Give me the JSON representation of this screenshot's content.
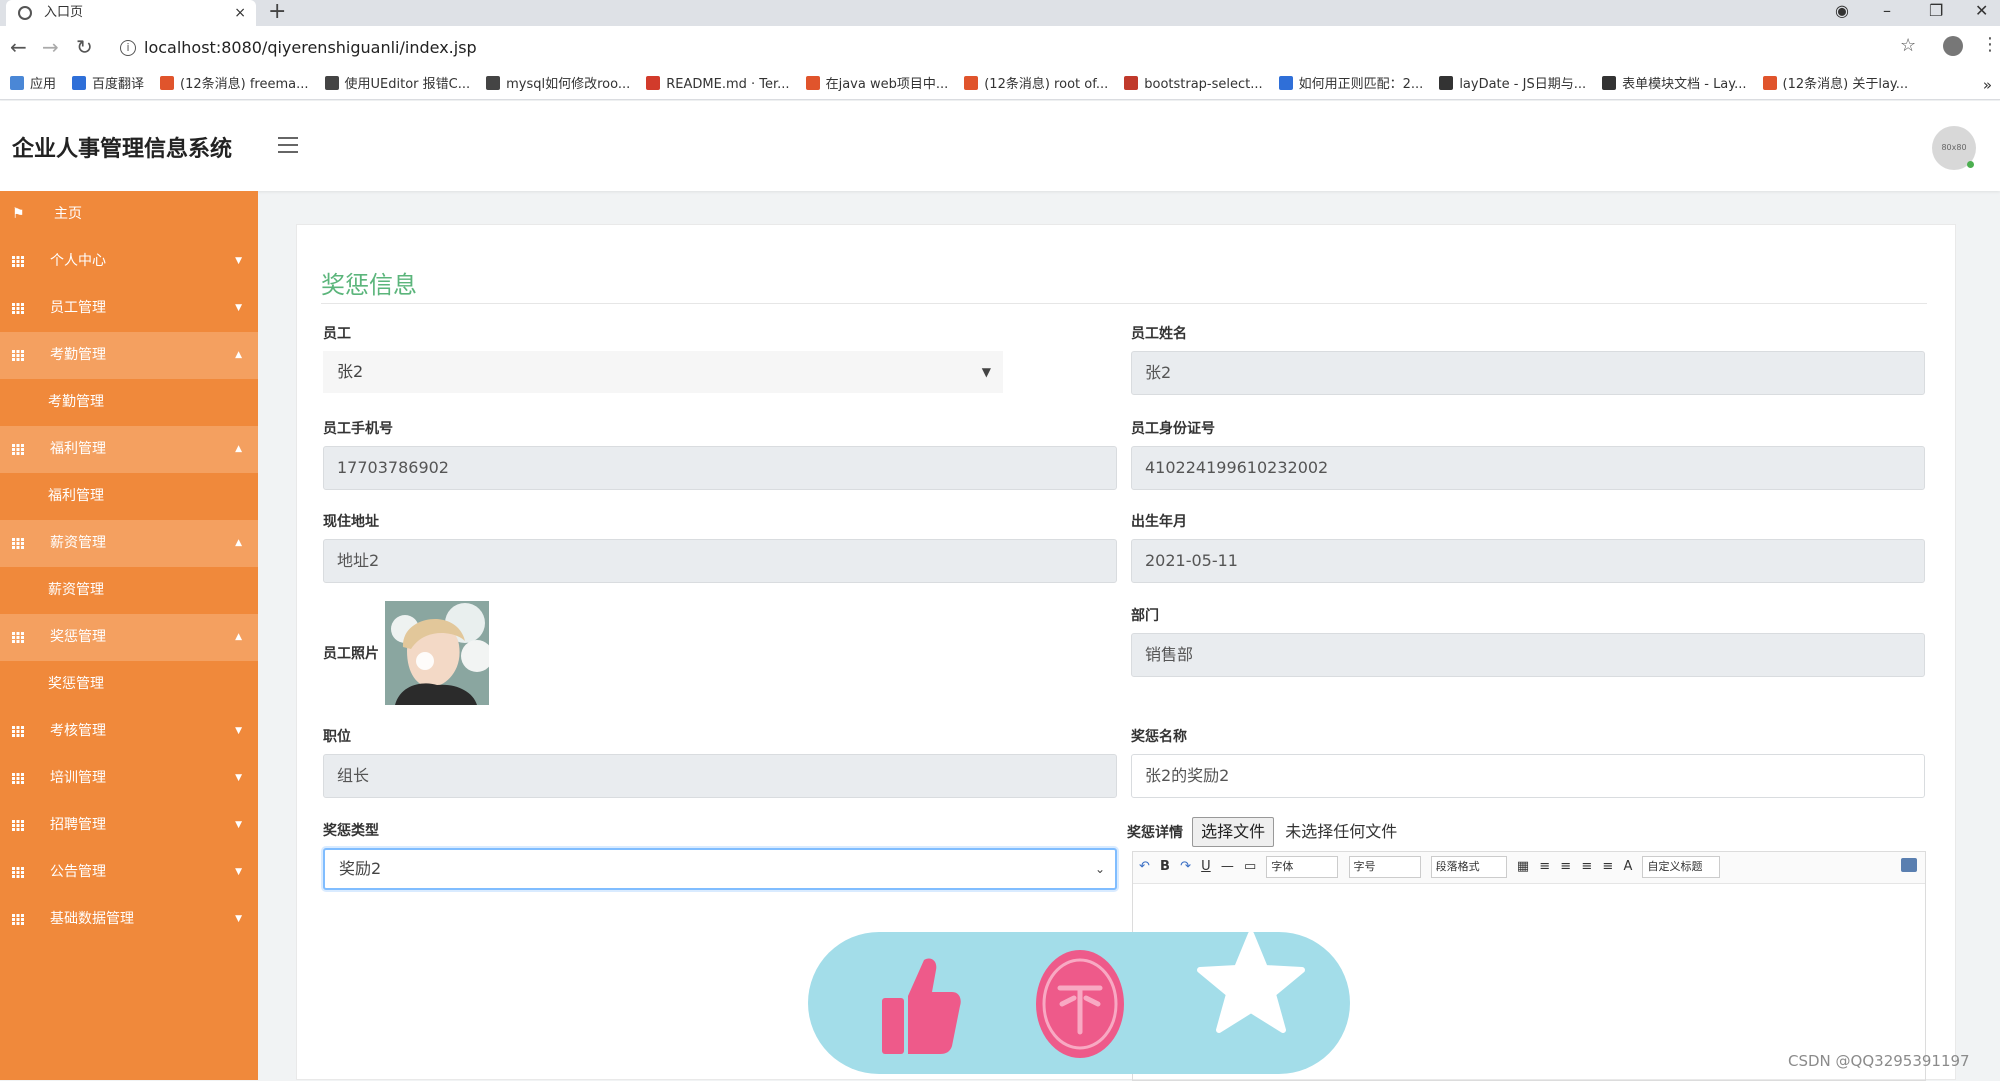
{
  "browser": {
    "tab_title": "入口页",
    "tab_close": "×",
    "new_tab": "+",
    "url": "localhost:8080/qiyerenshiguanli/index.jsp",
    "bookmarks": [
      {
        "label": "应用",
        "color": "#4a87d6"
      },
      {
        "label": "百度翻译",
        "color": "#2f6fd8"
      },
      {
        "label": "(12条消息) freema...",
        "color": "#e0542c"
      },
      {
        "label": "使用UEditor 报错C...",
        "color": "#444444"
      },
      {
        "label": "mysql如何修改roo...",
        "color": "#444444"
      },
      {
        "label": "README.md · Ter...",
        "color": "#d23b2b"
      },
      {
        "label": "在java web项目中...",
        "color": "#e0542c"
      },
      {
        "label": "(12条消息) root of...",
        "color": "#e0542c"
      },
      {
        "label": "bootstrap-select...",
        "color": "#c0392b"
      },
      {
        "label": "如何用正则匹配：2...",
        "color": "#2f6fd8"
      },
      {
        "label": "layDate - JS日期与...",
        "color": "#333333"
      },
      {
        "label": "表单模块文档 - Lay...",
        "color": "#333333"
      },
      {
        "label": "(12条消息) 关于lay...",
        "color": "#e0542c"
      }
    ],
    "bookmarks_more": "»"
  },
  "app": {
    "title": "企业人事管理信息系统",
    "avatar_text": "80x80"
  },
  "sidebar": {
    "items": [
      {
        "label": "主页",
        "icon": "flag-icon",
        "caret": ""
      },
      {
        "label": "个人中心",
        "icon": "grid-icon",
        "caret": "▼"
      },
      {
        "label": "员工管理",
        "icon": "grid-icon",
        "caret": "▼"
      },
      {
        "label": "考勤管理",
        "icon": "grid-icon",
        "caret": "▲",
        "sub": "考勤管理"
      },
      {
        "label": "福利管理",
        "icon": "grid-icon",
        "caret": "▲",
        "sub": "福利管理"
      },
      {
        "label": "薪资管理",
        "icon": "grid-icon",
        "caret": "▲",
        "sub": "薪资管理"
      },
      {
        "label": "奖惩管理",
        "icon": "grid-icon",
        "caret": "▲",
        "sub": "奖惩管理"
      },
      {
        "label": "考核管理",
        "icon": "grid-icon",
        "caret": "▼"
      },
      {
        "label": "培训管理",
        "icon": "grid-icon",
        "caret": "▼"
      },
      {
        "label": "招聘管理",
        "icon": "grid-icon",
        "caret": "▼"
      },
      {
        "label": "公告管理",
        "icon": "grid-icon",
        "caret": "▼"
      },
      {
        "label": "基础数据管理",
        "icon": "grid-icon",
        "caret": "▼"
      }
    ]
  },
  "form": {
    "section_title": "奖惩信息",
    "employee_label": "员工",
    "employee_value": "张2",
    "name_label": "员工姓名",
    "name_value": "张2",
    "phone_label": "员工手机号",
    "phone_value": "17703786902",
    "idcard_label": "员工身份证号",
    "idcard_value": "410224199610232002",
    "address_label": "现住地址",
    "address_value": "地址2",
    "birth_label": "出生年月",
    "birth_value": "2021-05-11",
    "photo_label": "员工照片",
    "dept_label": "部门",
    "dept_value": "销售部",
    "position_label": "职位",
    "position_value": "组长",
    "reward_name_label": "奖惩名称",
    "reward_name_value": "张2的奖励2",
    "reward_type_label": "奖惩类型",
    "reward_type_value": "奖励2",
    "detail_label": "奖惩详情",
    "file_button": "选择文件",
    "file_status": "未选择任何文件",
    "editor_font": "字体",
    "editor_size": "字号",
    "editor_paragraph": "段落格式",
    "editor_custom_title": "自定义标题"
  },
  "watermark": "CSDN @QQ3295391197"
}
